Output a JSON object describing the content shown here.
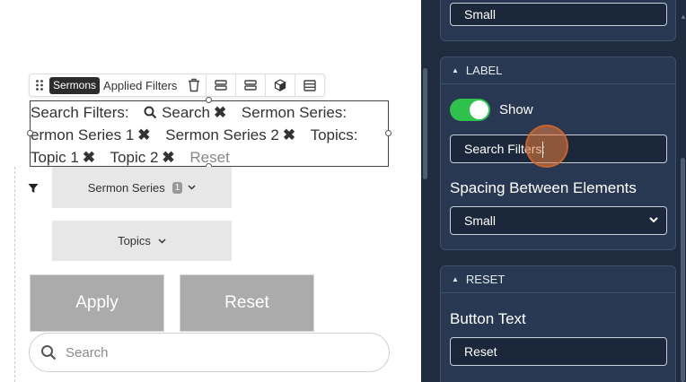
{
  "toolbar": {
    "badge": "Sermons",
    "label": "Applied Filters"
  },
  "filters": {
    "row1": {
      "label": "Search Filters:",
      "search_chip": "Search",
      "series_label": "Sermon Series:"
    },
    "row2": {
      "chip1": "ermon Series 1",
      "chip2": "Sermon Series 2",
      "topics_label": "Topics:"
    },
    "row3": {
      "chip1": "Topic 1",
      "chip2": "Topic 2",
      "reset": "Reset"
    }
  },
  "dropdowns": {
    "sermon_series": {
      "label": "Sermon Series",
      "count": "1"
    },
    "topics": {
      "label": "Topics"
    }
  },
  "buttons": {
    "apply": "Apply",
    "reset": "Reset"
  },
  "search": {
    "placeholder": "Search"
  },
  "panel": {
    "top_field_value": "Small",
    "label_section": {
      "title": "LABEL",
      "show_label": "Show",
      "show_enabled": true,
      "text_value": "Search Filters:",
      "spacing_label": "Spacing Between Elements",
      "spacing_value": "Small"
    },
    "reset_section": {
      "title": "RESET",
      "button_text_label": "Button Text",
      "button_text_value": "Reset"
    }
  },
  "colors": {
    "panel_bg": "#1f2b3f",
    "card_bg": "#283853",
    "toggle_on": "#2ec24d",
    "button_gray": "#ababab"
  },
  "icons": [
    "drag-handle-icon",
    "trash-icon",
    "layout-row-icon",
    "layout-rows-icon",
    "cube-icon",
    "list-icon",
    "search-icon",
    "close-icon",
    "funnel-icon",
    "chevron-down-icon",
    "caret-up-icon"
  ]
}
